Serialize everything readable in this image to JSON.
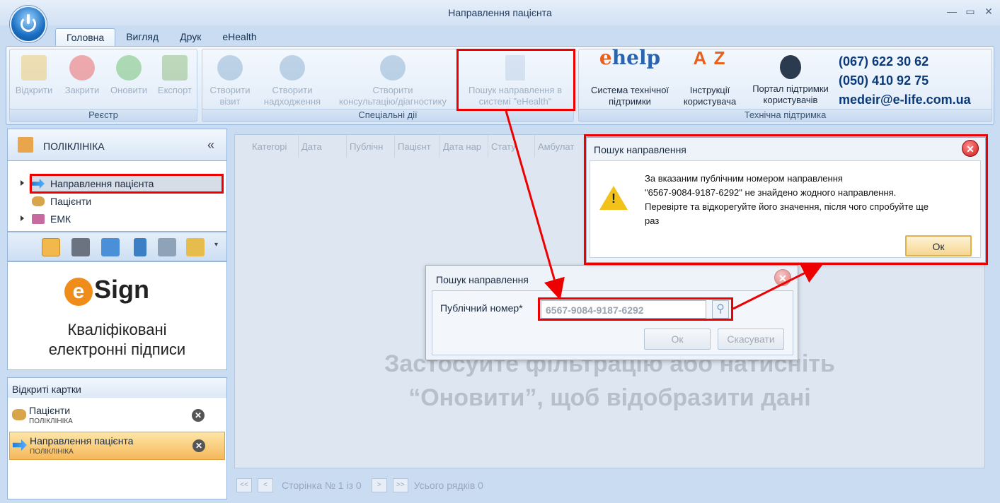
{
  "window": {
    "title": "Направлення пацієнта"
  },
  "tabs": [
    "Головна",
    "Вигляд",
    "Друк",
    "eHealth"
  ],
  "ribbon": {
    "registry": {
      "label": "Реєстр",
      "buttons": [
        "Відкрити",
        "Закрити",
        "Оновити",
        "Експорт"
      ]
    },
    "special": {
      "label": "Спеціальні дії",
      "buttons": [
        "Створити\nвізит",
        "Створити\nнадходження",
        "Створити\nконсультацію/діагностику",
        "Пошук направлення в\nсистемі \"eHealth\""
      ]
    },
    "support": {
      "label": "Технічна підтримка",
      "buttons": [
        "Система технічної\nпідтримки",
        "Інструкції\nкористувача",
        "Портал підтримки\nкористувачів"
      ],
      "ehelp_logo": "help",
      "az_logo": "A Z"
    },
    "phones": [
      "(067) 622 30 62",
      "(050) 410 92 75",
      "medeir@e-life.com.ua"
    ]
  },
  "left": {
    "header": "ПОЛІКЛІНІКА",
    "collapse": "«",
    "tree": [
      "Направлення пацієнта",
      "Пацієнти",
      "ЕМК"
    ],
    "esign": {
      "logo": "Sign",
      "text_line1": "Кваліфіковані",
      "text_line2": "електронні підписи"
    },
    "open_cards": {
      "title": "Відкриті картки",
      "cards": [
        {
          "label": "Пацієнти",
          "sub": "ПОЛІКЛІНІКА"
        },
        {
          "label": "Направлення пацієнта",
          "sub": "ПОЛІКЛІНІКА"
        }
      ]
    }
  },
  "grid": {
    "columns": [
      "Категорі",
      "Дата",
      "Публічн",
      "Пацієнт",
      "Дата нар",
      "Стату",
      "Амбулат"
    ],
    "placeholder_line1": "Застосуйте фільтрацію або натисніть",
    "placeholder_line2": "“Оновити”, щоб відобразити дані",
    "pager": {
      "text": "Сторінка № 1 із 0",
      "total": "Усього рядків 0",
      "first": "<<",
      "prev": "<",
      "next": ">",
      "last": ">>"
    }
  },
  "search_dialog": {
    "title": "Пошук направлення",
    "field_label": "Публічний номер*",
    "field_value": "6567-9084-9187-6292",
    "ok": "Ок",
    "cancel": "Скасувати"
  },
  "error_dialog": {
    "title": "Пошук направлення",
    "line1": "За вказаним публічним номером направлення",
    "line2": "\"6567-9084-9187-6292\" не знайдено жодного направлення.",
    "line3": "Перевірте та відкорегуйте його значення, після чого спробуйте ще",
    "line4": "раз",
    "ok": "Ок"
  },
  "colors": {
    "highlight": "#ee0000",
    "accent": "#1a6fc2",
    "orange": "#f08c1a"
  }
}
